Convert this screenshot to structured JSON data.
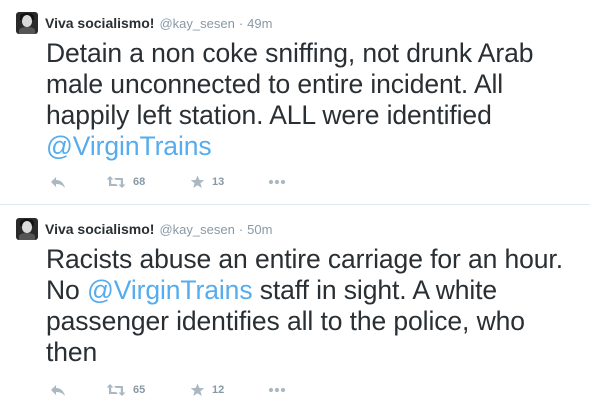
{
  "tweets": [
    {
      "author_name": "Viva socialismo!",
      "author_handle": "@kay_sesen",
      "separator": "·",
      "time": "49m",
      "text_plain": "Detain a non coke sniffing, not drunk Arab male unconnected to entire incident. All happily left station. ALL were identified ",
      "mention": "@VirginTrains",
      "text_after": "",
      "retweets": "68",
      "favorites": "13"
    },
    {
      "author_name": "Viva socialismo!",
      "author_handle": "@kay_sesen",
      "separator": "·",
      "time": "50m",
      "text_plain": "Racists abuse an entire carriage for an hour. No ",
      "mention": "@VirginTrains",
      "text_after": " staff in sight. A white passenger identifies all to the police, who then",
      "retweets": "65",
      "favorites": "12"
    }
  ],
  "icons": {
    "reply": "reply-icon",
    "retweet": "retweet-icon",
    "favorite": "star-icon",
    "more": "more-icon"
  },
  "colors": {
    "mention": "#55acee",
    "meta": "#8899a6",
    "icon": "#aab8c2",
    "text": "#292f33",
    "divider": "#e1e8ed"
  }
}
